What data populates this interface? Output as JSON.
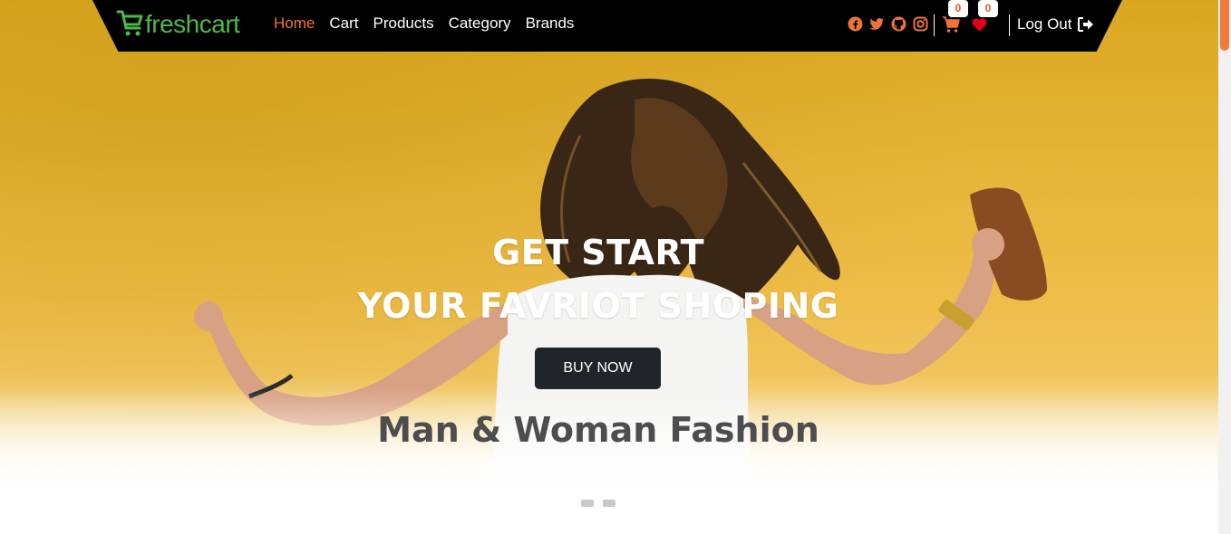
{
  "brand": {
    "name": "freshcart",
    "icon": "cart-icon",
    "color": "#4fb84a"
  },
  "nav": {
    "links": [
      {
        "label": "Home",
        "active": true
      },
      {
        "label": "Cart",
        "active": false
      },
      {
        "label": "Products",
        "active": false
      },
      {
        "label": "Category",
        "active": false
      },
      {
        "label": "Brands",
        "active": false
      }
    ],
    "active_color": "#f0743a"
  },
  "social": [
    "facebook-icon",
    "twitter-icon",
    "github-icon",
    "instagram-icon"
  ],
  "cart": {
    "icon": "cart-icon",
    "count": "0"
  },
  "wishlist": {
    "icon": "heart-icon",
    "count": "0"
  },
  "logout": {
    "label": "Log Out",
    "icon": "logout-icon"
  },
  "hero": {
    "headline_1": "GET START",
    "headline_2": "YOUR FAVRIOT SHOPING",
    "button": "BUY NOW",
    "tagline": "Man & Woman Fashion",
    "slides": 2,
    "background_color": "#e8b63a"
  }
}
